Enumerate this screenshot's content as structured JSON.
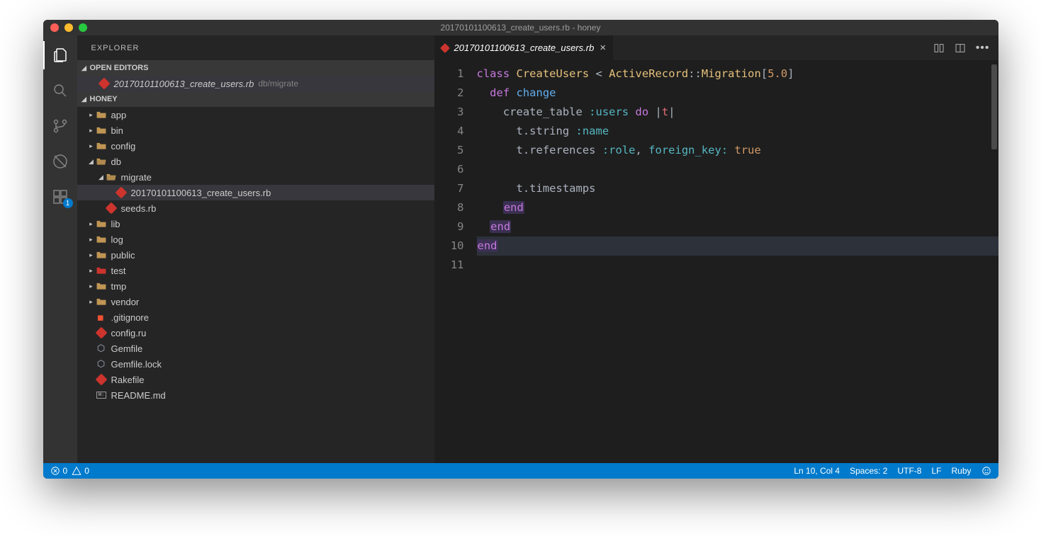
{
  "title": "20170101100613_create_users.rb - honey",
  "sidebar": {
    "title": "EXPLORER",
    "openEditorsLabel": "OPEN EDITORS",
    "openEditors": [
      {
        "name": "20170101100613_create_users.rb",
        "path": "db/migrate"
      }
    ],
    "projectLabel": "HONEY",
    "tree": [
      {
        "name": "app",
        "type": "folder",
        "depth": 0,
        "open": false
      },
      {
        "name": "bin",
        "type": "folder",
        "depth": 0,
        "open": false
      },
      {
        "name": "config",
        "type": "folder",
        "depth": 0,
        "open": false
      },
      {
        "name": "db",
        "type": "folder",
        "depth": 0,
        "open": true
      },
      {
        "name": "migrate",
        "type": "folder",
        "depth": 1,
        "open": true
      },
      {
        "name": "20170101100613_create_users.rb",
        "type": "ruby",
        "depth": 2,
        "selected": true
      },
      {
        "name": "seeds.rb",
        "type": "ruby",
        "depth": 1
      },
      {
        "name": "lib",
        "type": "folder",
        "depth": 0,
        "open": false
      },
      {
        "name": "log",
        "type": "folder",
        "depth": 0,
        "open": false
      },
      {
        "name": "public",
        "type": "folder",
        "depth": 0,
        "open": false
      },
      {
        "name": "test",
        "type": "folder-test",
        "depth": 0,
        "open": false
      },
      {
        "name": "tmp",
        "type": "folder",
        "depth": 0,
        "open": false
      },
      {
        "name": "vendor",
        "type": "folder",
        "depth": 0,
        "open": false
      },
      {
        "name": ".gitignore",
        "type": "git",
        "depth": 0
      },
      {
        "name": "config.ru",
        "type": "ruby",
        "depth": 0
      },
      {
        "name": "Gemfile",
        "type": "gem",
        "depth": 0
      },
      {
        "name": "Gemfile.lock",
        "type": "gem",
        "depth": 0
      },
      {
        "name": "Rakefile",
        "type": "ruby",
        "depth": 0
      },
      {
        "name": "README.md",
        "type": "md",
        "depth": 0
      }
    ]
  },
  "activity": {
    "extBadge": "1"
  },
  "tab": {
    "name": "20170101100613_create_users.rb"
  },
  "code": {
    "lines": [
      [
        [
          "kw",
          "class"
        ],
        [
          "",
          " "
        ],
        [
          "cls",
          "CreateUsers"
        ],
        [
          "",
          " "
        ],
        [
          "txt",
          "<"
        ],
        [
          "",
          " "
        ],
        [
          "cls",
          "ActiveRecord"
        ],
        [
          "txt",
          "::"
        ],
        [
          "cls",
          "Migration"
        ],
        [
          "txt",
          "["
        ],
        [
          "num",
          "5.0"
        ],
        [
          "txt",
          "]"
        ]
      ],
      [
        [
          "",
          "  "
        ],
        [
          "kw",
          "def"
        ],
        [
          "",
          " "
        ],
        [
          "fn",
          "change"
        ]
      ],
      [
        [
          "",
          "    "
        ],
        [
          "txt",
          "create_table "
        ],
        [
          "sym",
          ":users"
        ],
        [
          "",
          " "
        ],
        [
          "kw",
          "do"
        ],
        [
          "",
          " |"
        ],
        [
          "var",
          "t"
        ],
        [
          "",
          "|"
        ]
      ],
      [
        [
          "",
          "      "
        ],
        [
          "txt",
          "t.string "
        ],
        [
          "sym",
          ":name"
        ]
      ],
      [
        [
          "",
          "      "
        ],
        [
          "txt",
          "t.references "
        ],
        [
          "sym",
          ":role"
        ],
        [
          "txt",
          ", "
        ],
        [
          "sym",
          "foreign_key:"
        ],
        [
          "",
          " "
        ],
        [
          "num",
          "true"
        ]
      ],
      [],
      [
        [
          "",
          "      "
        ],
        [
          "txt",
          "t.timestamps"
        ]
      ],
      [
        [
          "",
          "    "
        ],
        [
          "kw2",
          "end"
        ]
      ],
      [
        [
          "",
          "  "
        ],
        [
          "kw2",
          "end"
        ]
      ],
      [
        [
          "kw2",
          "end"
        ]
      ],
      []
    ],
    "highlightLine": 10
  },
  "status": {
    "errors": "0",
    "warnings": "0",
    "lnCol": "Ln 10, Col 4",
    "spaces": "Spaces: 2",
    "encoding": "UTF-8",
    "eol": "LF",
    "lang": "Ruby"
  }
}
